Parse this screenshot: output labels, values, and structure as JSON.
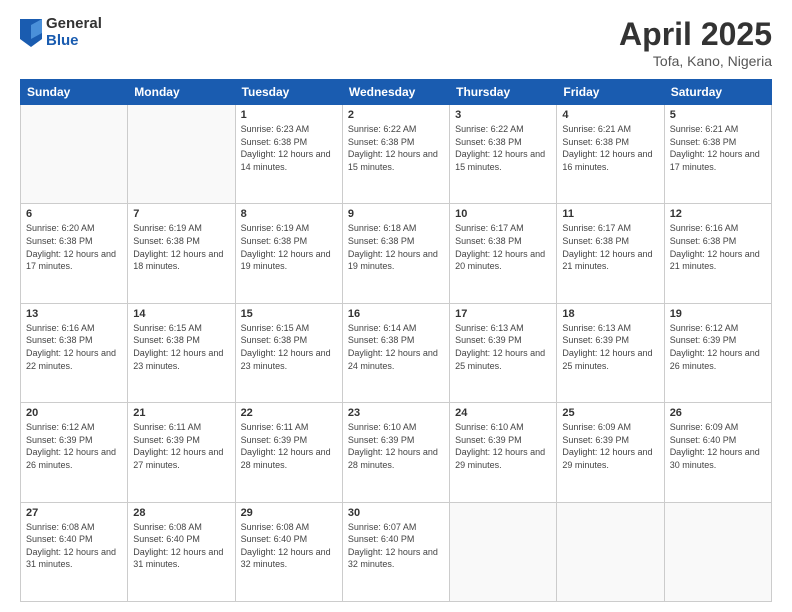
{
  "logo": {
    "general": "General",
    "blue": "Blue"
  },
  "title": {
    "month_year": "April 2025",
    "location": "Tofa, Kano, Nigeria"
  },
  "days_of_week": [
    "Sunday",
    "Monday",
    "Tuesday",
    "Wednesday",
    "Thursday",
    "Friday",
    "Saturday"
  ],
  "weeks": [
    [
      {
        "day": "",
        "info": ""
      },
      {
        "day": "",
        "info": ""
      },
      {
        "day": "1",
        "info": "Sunrise: 6:23 AM\nSunset: 6:38 PM\nDaylight: 12 hours and 14 minutes."
      },
      {
        "day": "2",
        "info": "Sunrise: 6:22 AM\nSunset: 6:38 PM\nDaylight: 12 hours and 15 minutes."
      },
      {
        "day": "3",
        "info": "Sunrise: 6:22 AM\nSunset: 6:38 PM\nDaylight: 12 hours and 15 minutes."
      },
      {
        "day": "4",
        "info": "Sunrise: 6:21 AM\nSunset: 6:38 PM\nDaylight: 12 hours and 16 minutes."
      },
      {
        "day": "5",
        "info": "Sunrise: 6:21 AM\nSunset: 6:38 PM\nDaylight: 12 hours and 17 minutes."
      }
    ],
    [
      {
        "day": "6",
        "info": "Sunrise: 6:20 AM\nSunset: 6:38 PM\nDaylight: 12 hours and 17 minutes."
      },
      {
        "day": "7",
        "info": "Sunrise: 6:19 AM\nSunset: 6:38 PM\nDaylight: 12 hours and 18 minutes."
      },
      {
        "day": "8",
        "info": "Sunrise: 6:19 AM\nSunset: 6:38 PM\nDaylight: 12 hours and 19 minutes."
      },
      {
        "day": "9",
        "info": "Sunrise: 6:18 AM\nSunset: 6:38 PM\nDaylight: 12 hours and 19 minutes."
      },
      {
        "day": "10",
        "info": "Sunrise: 6:17 AM\nSunset: 6:38 PM\nDaylight: 12 hours and 20 minutes."
      },
      {
        "day": "11",
        "info": "Sunrise: 6:17 AM\nSunset: 6:38 PM\nDaylight: 12 hours and 21 minutes."
      },
      {
        "day": "12",
        "info": "Sunrise: 6:16 AM\nSunset: 6:38 PM\nDaylight: 12 hours and 21 minutes."
      }
    ],
    [
      {
        "day": "13",
        "info": "Sunrise: 6:16 AM\nSunset: 6:38 PM\nDaylight: 12 hours and 22 minutes."
      },
      {
        "day": "14",
        "info": "Sunrise: 6:15 AM\nSunset: 6:38 PM\nDaylight: 12 hours and 23 minutes."
      },
      {
        "day": "15",
        "info": "Sunrise: 6:15 AM\nSunset: 6:38 PM\nDaylight: 12 hours and 23 minutes."
      },
      {
        "day": "16",
        "info": "Sunrise: 6:14 AM\nSunset: 6:38 PM\nDaylight: 12 hours and 24 minutes."
      },
      {
        "day": "17",
        "info": "Sunrise: 6:13 AM\nSunset: 6:39 PM\nDaylight: 12 hours and 25 minutes."
      },
      {
        "day": "18",
        "info": "Sunrise: 6:13 AM\nSunset: 6:39 PM\nDaylight: 12 hours and 25 minutes."
      },
      {
        "day": "19",
        "info": "Sunrise: 6:12 AM\nSunset: 6:39 PM\nDaylight: 12 hours and 26 minutes."
      }
    ],
    [
      {
        "day": "20",
        "info": "Sunrise: 6:12 AM\nSunset: 6:39 PM\nDaylight: 12 hours and 26 minutes."
      },
      {
        "day": "21",
        "info": "Sunrise: 6:11 AM\nSunset: 6:39 PM\nDaylight: 12 hours and 27 minutes."
      },
      {
        "day": "22",
        "info": "Sunrise: 6:11 AM\nSunset: 6:39 PM\nDaylight: 12 hours and 28 minutes."
      },
      {
        "day": "23",
        "info": "Sunrise: 6:10 AM\nSunset: 6:39 PM\nDaylight: 12 hours and 28 minutes."
      },
      {
        "day": "24",
        "info": "Sunrise: 6:10 AM\nSunset: 6:39 PM\nDaylight: 12 hours and 29 minutes."
      },
      {
        "day": "25",
        "info": "Sunrise: 6:09 AM\nSunset: 6:39 PM\nDaylight: 12 hours and 29 minutes."
      },
      {
        "day": "26",
        "info": "Sunrise: 6:09 AM\nSunset: 6:40 PM\nDaylight: 12 hours and 30 minutes."
      }
    ],
    [
      {
        "day": "27",
        "info": "Sunrise: 6:08 AM\nSunset: 6:40 PM\nDaylight: 12 hours and 31 minutes."
      },
      {
        "day": "28",
        "info": "Sunrise: 6:08 AM\nSunset: 6:40 PM\nDaylight: 12 hours and 31 minutes."
      },
      {
        "day": "29",
        "info": "Sunrise: 6:08 AM\nSunset: 6:40 PM\nDaylight: 12 hours and 32 minutes."
      },
      {
        "day": "30",
        "info": "Sunrise: 6:07 AM\nSunset: 6:40 PM\nDaylight: 12 hours and 32 minutes."
      },
      {
        "day": "",
        "info": ""
      },
      {
        "day": "",
        "info": ""
      },
      {
        "day": "",
        "info": ""
      }
    ]
  ]
}
